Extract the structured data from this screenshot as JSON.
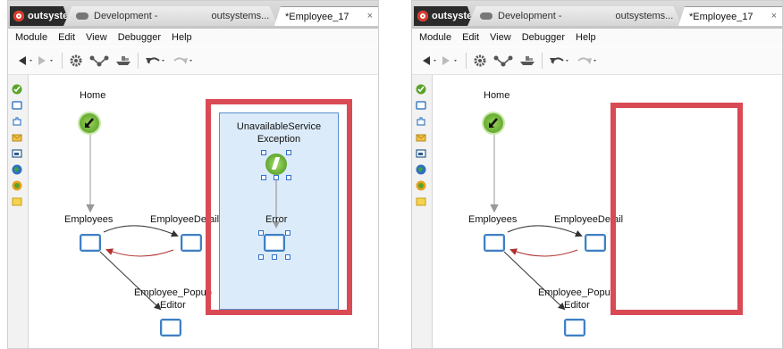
{
  "tabs": {
    "brand": "outsystems",
    "dev_left": "Development -",
    "dev_right": "outsystems...",
    "active": "*Employee_17",
    "close": "×"
  },
  "menu": [
    "Module",
    "Edit",
    "View",
    "Debugger",
    "Help"
  ],
  "nodes": {
    "home": "Home",
    "exception_line1": "UnavailableService",
    "exception_line2": "Exception",
    "error": "Error",
    "employees": "Employees",
    "employee_detail": "EmployeeDetail",
    "popup_line1": "Employee_Popup",
    "popup_line2": "Editor"
  },
  "colors": {
    "highlight_frame": "#d94a55",
    "selection_fill": "#dcebf9",
    "screen_border": "#3f7fc4",
    "link_dark": "#333333",
    "link_red": "#b03030"
  },
  "icons": {
    "toolbar": [
      "back-arrow-icon",
      "forward-arrow-icon",
      "gear-icon",
      "flow-icon",
      "ship-icon",
      "undo-icon",
      "redo-icon"
    ],
    "sidebar": [
      "checkmark-icon",
      "screen-icon",
      "puzzle-icon",
      "envelope-icon",
      "window-icon",
      "globe-icon",
      "circle-icon",
      "note-icon"
    ]
  }
}
